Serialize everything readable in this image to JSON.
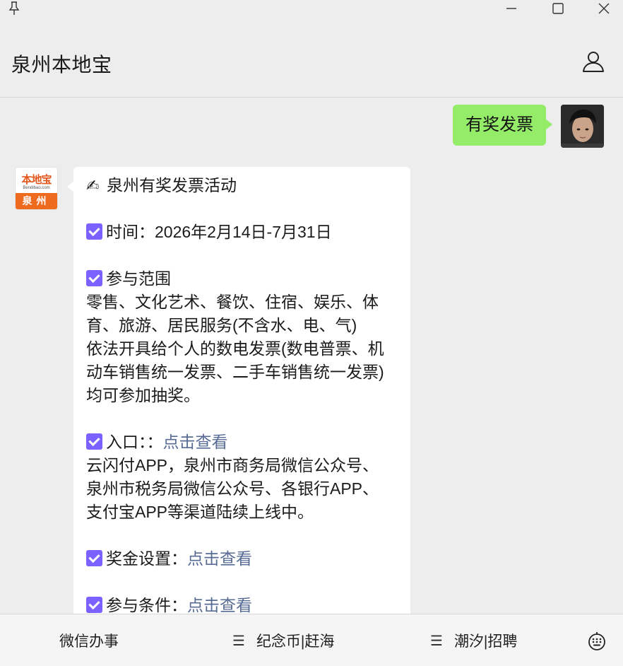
{
  "window": {
    "pin_icon": "pin-icon",
    "minimize_icon": "minimize-icon",
    "maximize_icon": "maximize-icon",
    "close_icon": "close-icon"
  },
  "header": {
    "title": "泉州本地宝",
    "profile_icon": "person-icon"
  },
  "outgoing": {
    "text": "有奖发票",
    "bubble_color": "#95ec69"
  },
  "avatar_logo": {
    "top": "本地宝",
    "sub": "Bendibao.com",
    "bottom": "泉州",
    "brand_color": "#ee6a1f"
  },
  "message": {
    "title": "泉州有奖发票活动",
    "time_label": "时间：2026年2月14日-7月31日",
    "scope_label": "参与范围",
    "scope_lines": [
      "零售、文化艺术、餐饮、住宿、娱乐、体",
      "育、旅游、居民服务(不含水、电、气)",
      "依法开具给个人的数电发票(数电普票、机",
      "动车销售统一发票、二手车销售统一发票)",
      "均可参加抽奖。"
    ],
    "entry_label": "入口：：",
    "entry_link": "点击查看",
    "entry_lines": [
      "云闪付APP，泉州市商务局微信公众号、",
      "泉州市税务局微信公众号、各银行APP、",
      "支付宝APP等渠道陆续上线中。"
    ],
    "prize_label": "奖金设置：",
    "prize_link": "点击查看",
    "cond_label": "参与条件：",
    "cond_link": "点击查看",
    "check_color": "#7b61ff",
    "link_color": "#576b95"
  },
  "bottom_menu": {
    "item1": "微信办事",
    "item2": "纪念币|赶海",
    "item3": "潮汐|招聘",
    "menu_glyph": "☰",
    "keyboard_icon": "keyboard-icon"
  }
}
